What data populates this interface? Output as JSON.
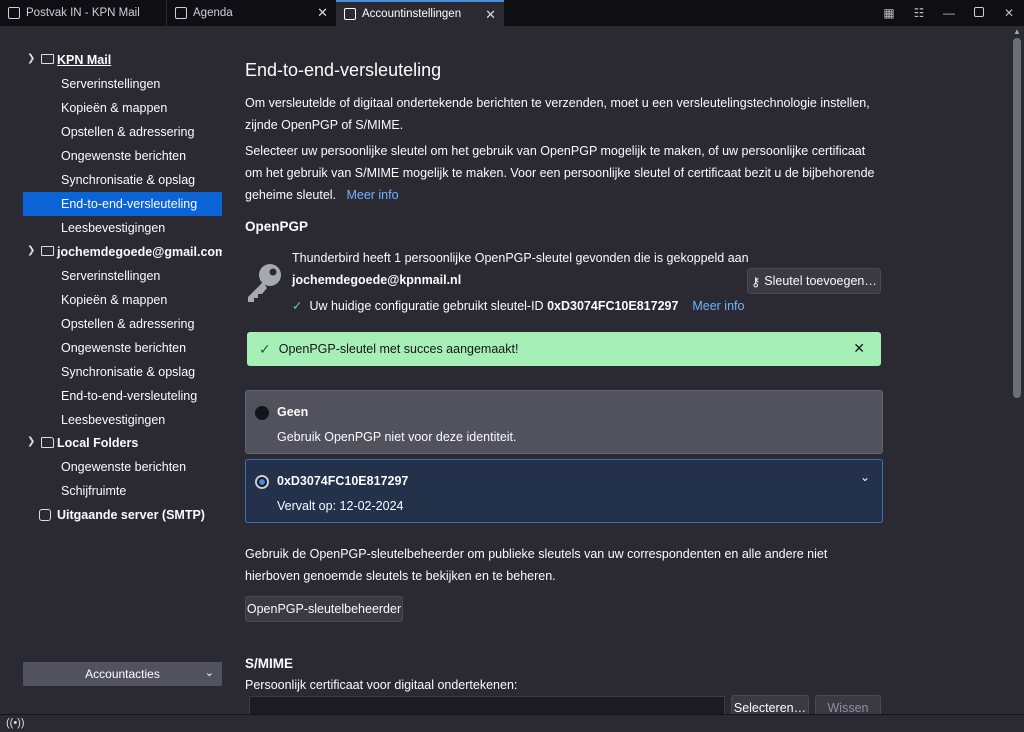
{
  "tabs": [
    {
      "label": "Postvak IN - KPN Mail",
      "icon": "mail-icon"
    },
    {
      "label": "Agenda",
      "icon": "calendar-icon"
    },
    {
      "label": "Accountinstellingen",
      "icon": "settings-tab-icon"
    }
  ],
  "sidebar": {
    "accounts": [
      {
        "name": "KPN Mail",
        "items": [
          "Serverinstellingen",
          "Kopieën & mappen",
          "Opstellen & adressering",
          "Ongewenste berichten",
          "Synchronisatie & opslag",
          "End-to-end-versleuteling",
          "Leesbevestigingen"
        ]
      },
      {
        "name": "jochemdegoede@gmail.com",
        "items": [
          "Serverinstellingen",
          "Kopieën & mappen",
          "Opstellen & adressering",
          "Ongewenste berichten",
          "Synchronisatie & opslag",
          "End-to-end-versleuteling",
          "Leesbevestigingen"
        ]
      },
      {
        "name": "Local Folders",
        "items": [
          "Ongewenste berichten",
          "Schijfruimte"
        ]
      },
      {
        "name": "Uitgaande server (SMTP)",
        "items": []
      }
    ],
    "selected": "KPN Mail / End-to-end-versleuteling",
    "account_actions": "Accountacties"
  },
  "main": {
    "title": "End-to-end-versleuteling",
    "intro1": "Om versleutelde of digitaal ondertekende berichten te verzenden, moet u een versleutelingstechnologie instellen, zijnde OpenPGP of S/MIME.",
    "intro2": "Selecteer uw persoonlijke sleutel om het gebruik van OpenPGP mogelijk te maken, of uw persoonlijke certificaat om het gebruik van S/MIME mogelijk te maken. Voor een persoonlijke sleutel of certificaat bezit u de bijbehorende geheime sleutel.",
    "more_info": "Meer info",
    "openpgp_heading": "OpenPGP",
    "found_text": "Thunderbird heeft 1 persoonlijke OpenPGP-sleutel gevonden die is gekoppeld aan",
    "email": "jochemdegoede@kpnmail.nl",
    "config_prefix": "Uw huidige configuratie gebruikt sleutel-ID",
    "key_id": "0xD3074FC10E817297",
    "add_key_button": "Sleutel toevoegen…",
    "notice": "OpenPGP-sleutel met succes aangemaakt!",
    "option_none_title": "Geen",
    "option_none_desc": "Gebruik OpenPGP niet voor deze identiteit.",
    "option_key_title": "0xD3074FC10E817297",
    "option_key_desc": "Vervalt op: 12-02-2024",
    "manager_text": "Gebruik de OpenPGP-sleutelbeheerder om publieke sleutels van uw correspondenten en alle andere niet hierboven genoemde sleutels te bekijken en te beheren.",
    "manager_button": "OpenPGP-sleutelbeheerder",
    "smime_heading": "S/MIME",
    "smime_label": "Persoonlijk certificaat voor digitaal ondertekenen:",
    "select_button": "Selecteren…",
    "clear_button": "Wissen"
  }
}
